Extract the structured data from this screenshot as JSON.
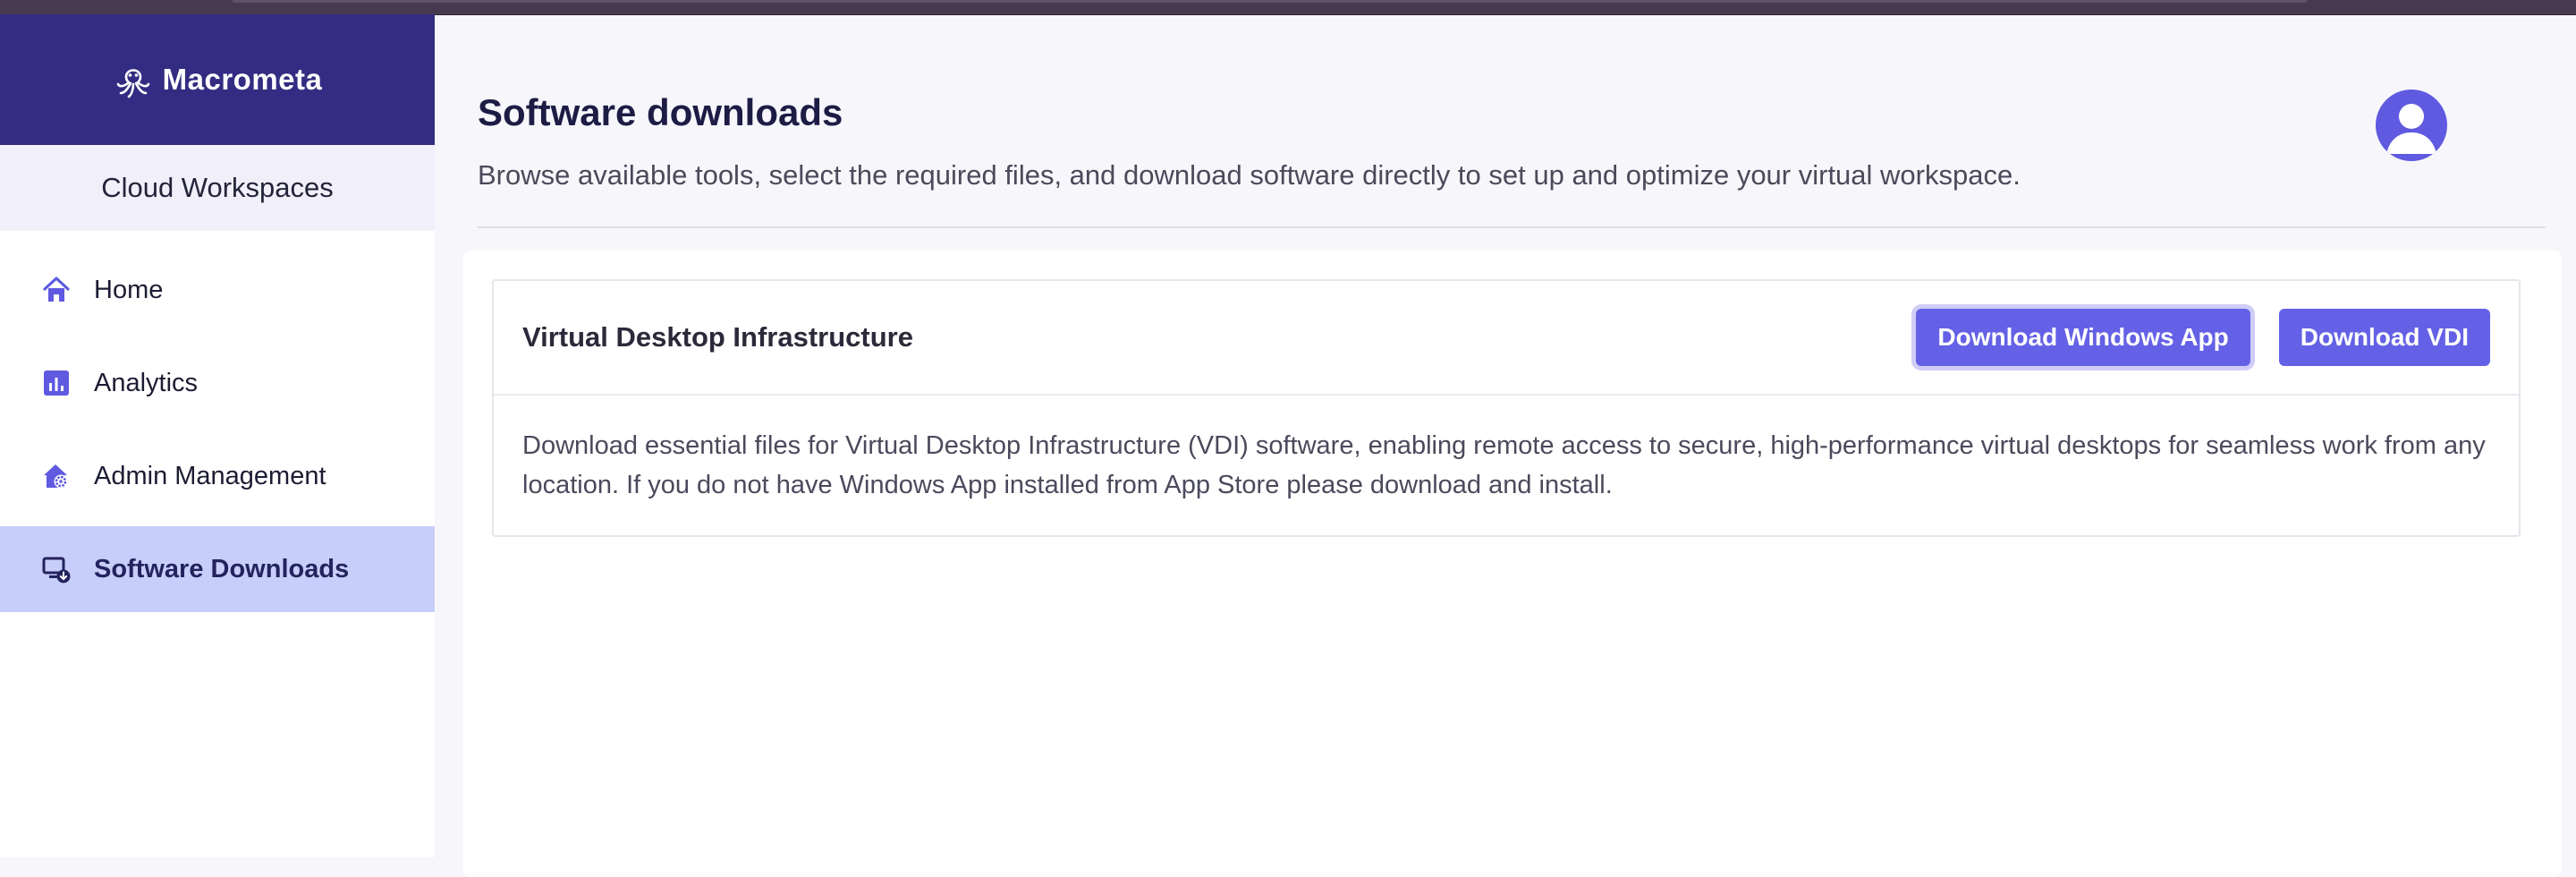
{
  "brand": {
    "name": "Macrometa"
  },
  "sidebar": {
    "workspace_label": "Cloud Workspaces",
    "items": [
      {
        "label": "Home",
        "icon": "home-icon"
      },
      {
        "label": "Analytics",
        "icon": "analytics-icon"
      },
      {
        "label": "Admin Management",
        "icon": "admin-management-icon"
      },
      {
        "label": "Software Downloads",
        "icon": "software-downloads-icon",
        "active": true
      }
    ]
  },
  "header": {
    "title": "Software downloads",
    "subtitle": "Browse available tools, select the required files, and download software directly to set up and optimize your virtual workspace."
  },
  "card": {
    "title": "Virtual Desktop Infrastructure",
    "primary_button": "Download Windows App",
    "secondary_button": "Download VDI",
    "description": "Download essential files for Virtual Desktop Infrastructure (VDI) software, enabling remote access to secure, high-performance virtual desktops for seamless work from any location. If you do not have Windows App installed from App Store please download and install."
  },
  "colors": {
    "brand_header": "#322c82",
    "accent": "#6461e6",
    "active_nav": "#c8cefa",
    "icon": "#5f5ae0"
  }
}
